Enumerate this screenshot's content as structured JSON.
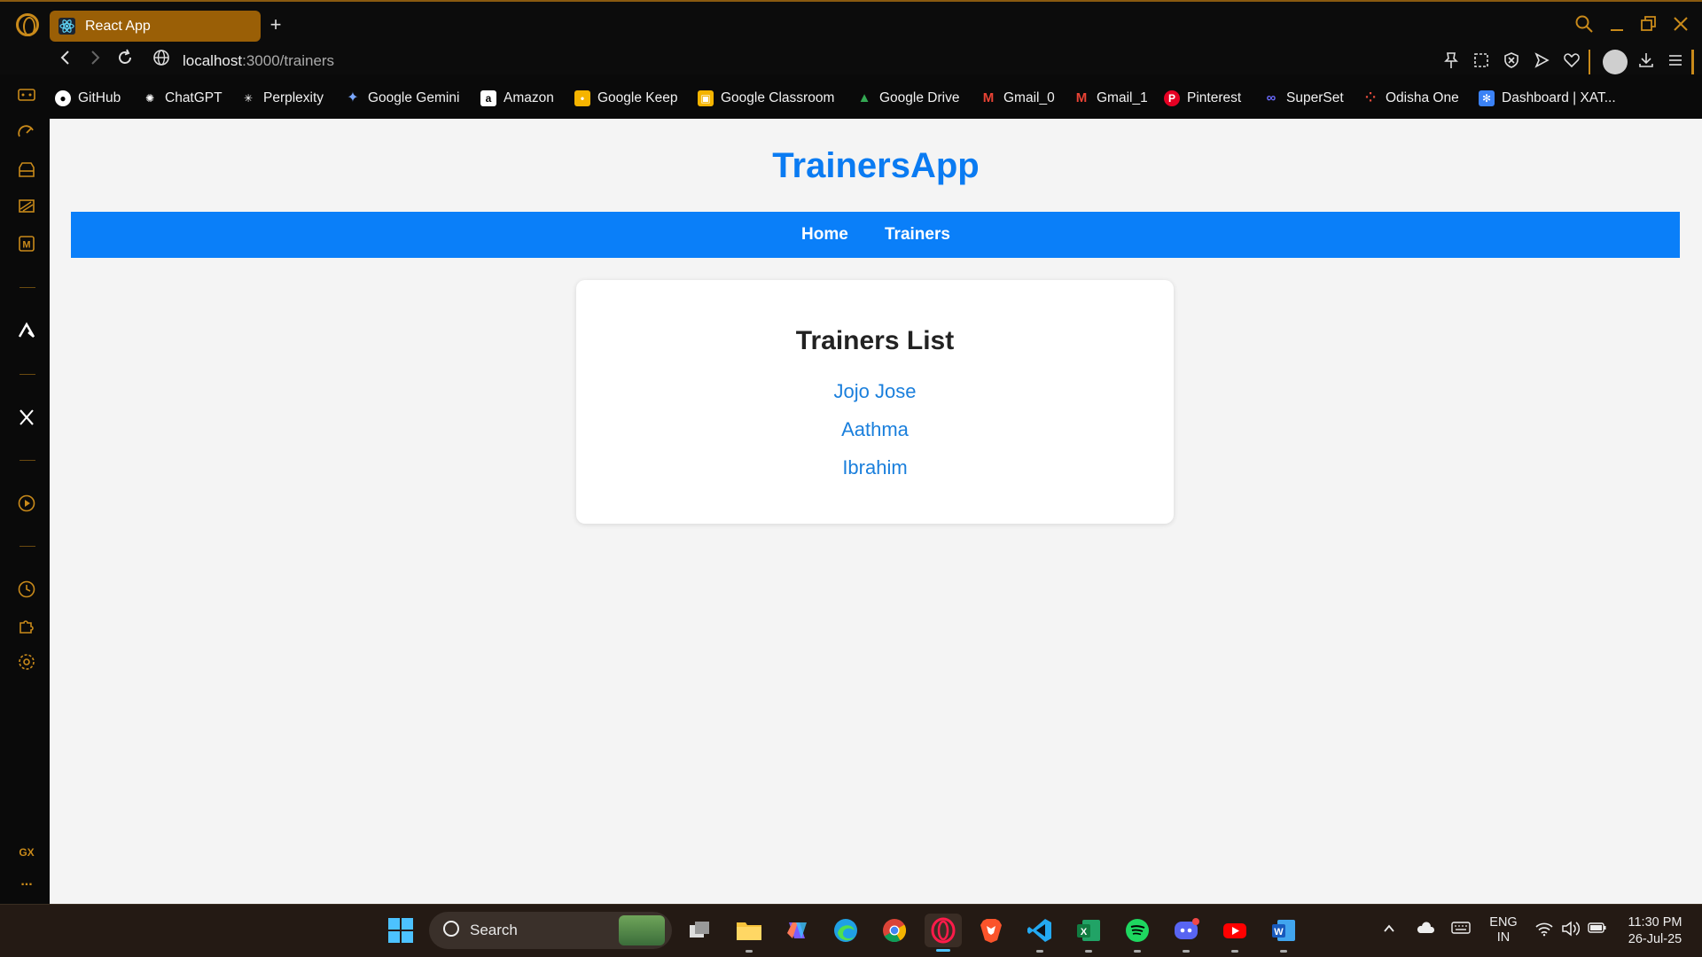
{
  "browser": {
    "tab_title": "React App",
    "new_tab_label": "+",
    "url_host": "localhost",
    "url_path": ":3000/trainers"
  },
  "bookmarks": [
    {
      "label": "GitHub",
      "icon": "github-icon",
      "color": "#ffffff"
    },
    {
      "label": "ChatGPT",
      "icon": "chatgpt-icon",
      "color": "#ffffff"
    },
    {
      "label": "Perplexity",
      "icon": "perplexity-icon",
      "color": "#ffffff"
    },
    {
      "label": "Google Gemini",
      "icon": "gemini-icon",
      "color": "#7aa7ff"
    },
    {
      "label": "Amazon",
      "icon": "amazon-icon",
      "color": "#ffffff"
    },
    {
      "label": "Google Keep",
      "icon": "keep-icon",
      "color": "#f6b400"
    },
    {
      "label": "Google Classroom",
      "icon": "classroom-icon",
      "color": "#f4b400"
    },
    {
      "label": "Google Drive",
      "icon": "drive-icon",
      "color": "#34a853"
    },
    {
      "label": "Gmail_0",
      "icon": "gmail-icon",
      "color": "#ea4335"
    },
    {
      "label": "Gmail_1",
      "icon": "gmail-icon",
      "color": "#ea4335"
    },
    {
      "label": "Pinterest",
      "icon": "pinterest-icon",
      "color": "#e60023"
    },
    {
      "label": "SuperSet",
      "icon": "superset-icon",
      "color": "#6b6bff"
    },
    {
      "label": "Odisha One",
      "icon": "odisha-one-icon",
      "color": "#e74c3c"
    },
    {
      "label": "Dashboard | XAT...",
      "icon": "dashboard-icon",
      "color": "#3b82f6"
    }
  ],
  "page": {
    "app_title": "TrainersApp",
    "nav": {
      "home": "Home",
      "trainers": "Trainers"
    },
    "list_title": "Trainers List",
    "trainers": [
      "Jojo Jose",
      "Aathma",
      "Ibrahim"
    ]
  },
  "taskbar": {
    "search_label": "Search",
    "lang_top": "ENG",
    "lang_bottom": "IN",
    "time": "11:30 PM",
    "date": "26-Jul-25"
  },
  "sidebar": {
    "gx_label": "GX",
    "more_label": "..."
  },
  "colors": {
    "accent": "#0a7ff9",
    "title": "#0a7bf2",
    "link": "#1a7fdc",
    "opera_gx": "#c98a1a"
  }
}
